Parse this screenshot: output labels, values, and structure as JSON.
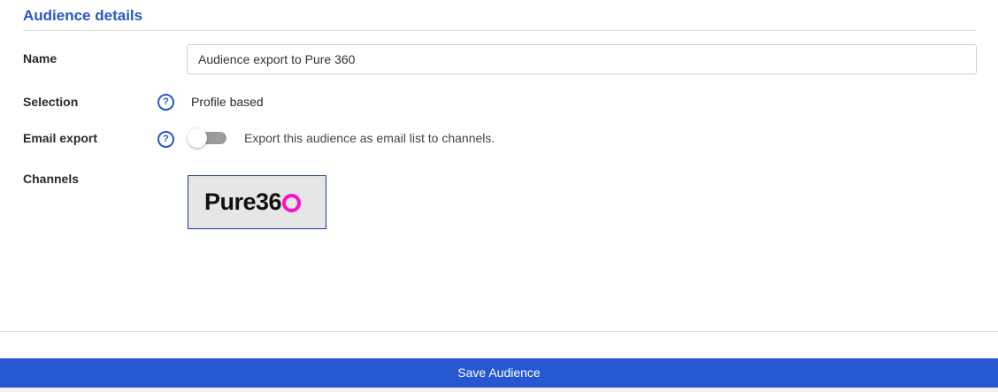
{
  "section": {
    "title": "Audience details"
  },
  "fields": {
    "name": {
      "label": "Name",
      "value": "Audience export to Pure 360"
    },
    "selection": {
      "label": "Selection",
      "help_icon": "question-circle-icon",
      "value": "Profile based"
    },
    "email_export": {
      "label": "Email export",
      "help_icon": "question-circle-icon",
      "toggle_on": false,
      "description": "Export this audience as email list to channels."
    },
    "channels": {
      "label": "Channels",
      "items": [
        {
          "logo_text": "Pure36",
          "logo_ring_color": "#ff10c8",
          "selected": true
        }
      ]
    }
  },
  "actions": {
    "save_label": "Save Audience"
  },
  "colors": {
    "accent": "#2857c5",
    "button": "#2658d2",
    "toggle_off": "#9b9b9b"
  }
}
